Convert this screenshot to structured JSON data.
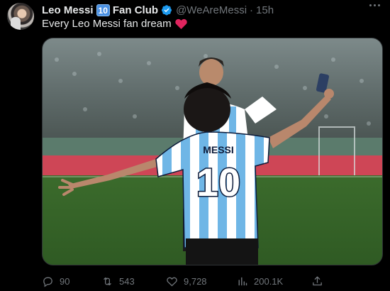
{
  "tweet": {
    "author_name": "Leo Messi",
    "number_emoji": "10",
    "author_suffix": "Fan Club",
    "handle": "@WeAreMessi",
    "separator": "·",
    "time": "15h",
    "text": "Every Leo Messi fan dream",
    "emoji": "red-heart",
    "media": {
      "jersey_name": "MESSI",
      "jersey_number": "10"
    },
    "actions": {
      "replies": "90",
      "retweets": "543",
      "likes": "9,728",
      "views": "200.1K"
    }
  },
  "colors": {
    "background": "#000000",
    "text_primary": "#e7e9ea",
    "text_secondary": "#71767b",
    "verified": "#1d9bf0",
    "heart": "#e0245e"
  },
  "icons": [
    "verified-badge-icon",
    "more-icon",
    "reply-icon",
    "retweet-icon",
    "like-icon",
    "views-icon",
    "share-icon"
  ]
}
